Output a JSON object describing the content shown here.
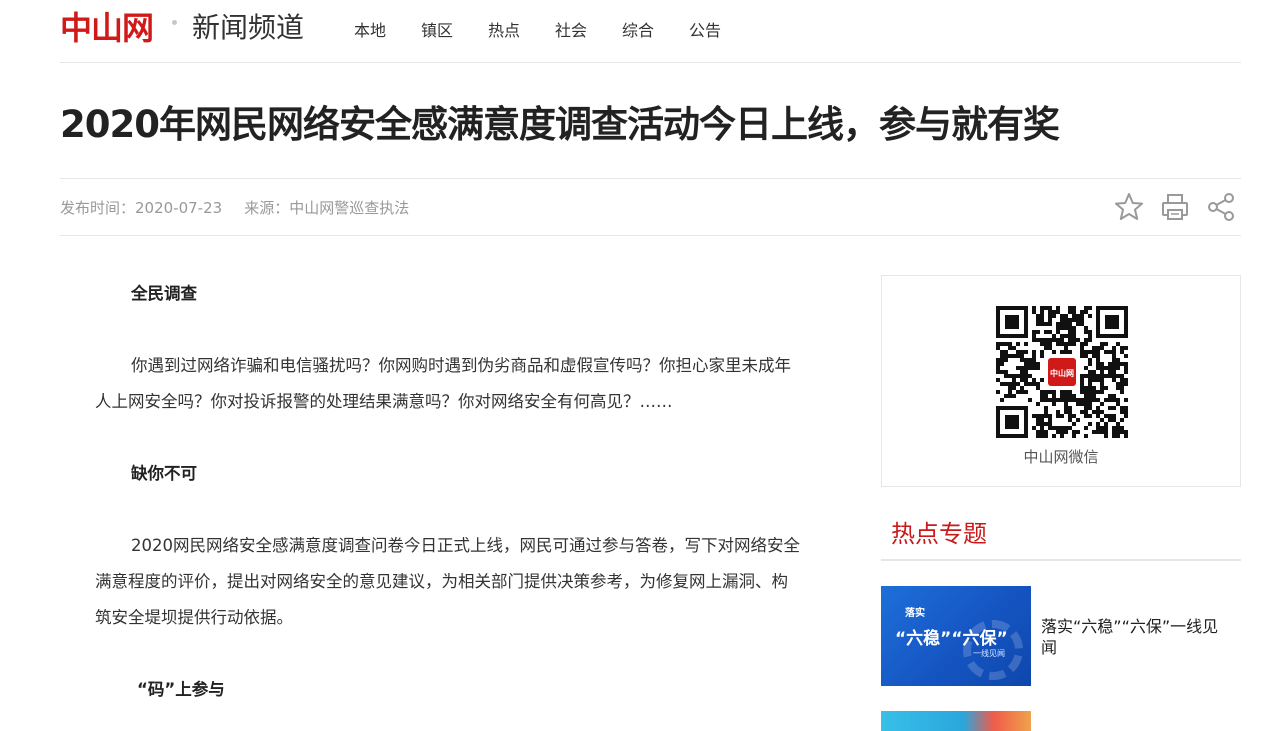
{
  "header": {
    "logo": "中山网",
    "channel": "新闻频道",
    "nav": [
      "本地",
      "镇区",
      "热点",
      "社会",
      "综合",
      "公告"
    ]
  },
  "article": {
    "title": "2020年网民网络安全感满意度调查活动今日上线，参与就有奖",
    "publish_time": "发布时间：2020-07-23",
    "source": "来源：中山网警巡查执法",
    "tools": [
      "star-icon",
      "print-icon",
      "share-icon"
    ],
    "paragraphs": {
      "h1": "全民调查",
      "p1": "你遇到过网络诈骗和电信骚扰吗？你网购时遇到伪劣商品和虚假宣传吗？你担心家里未成年人上网安全吗？你对投诉报警的处理结果满意吗？你对网络安全有何高见？……",
      "h2": "缺你不可",
      "p2": "2020网民网络安全感满意度调查问卷今日正式上线，网民可通过参与答卷，写下对网络安全满意程度的评价，提出对网络安全的意见建议，为相关部门提供决策参考，为修复网上漏洞、构筑安全堤坝提供行动依据。",
      "h3": "“码”上参与"
    }
  },
  "sidebar": {
    "qr_caption": "中山网微信",
    "qr_logo": "中山网",
    "hot_title": "热点专题",
    "topic1": {
      "thumb_small": "落实",
      "thumb_big": "“六稳”“六保”",
      "thumb_sub": "一线见闻",
      "text": "落实“六稳”“六保”一线见闻"
    }
  },
  "colors": {
    "brand_red": "#d01a1a",
    "hot_red": "#c81a1a",
    "meta_gray": "#999999"
  }
}
